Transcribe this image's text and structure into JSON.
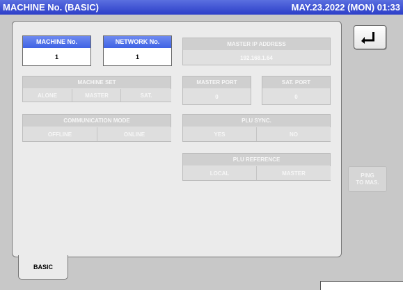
{
  "header": {
    "title": "MACHINE No. (BASIC)",
    "datetime": "MAY.23.2022 (MON) 01:33"
  },
  "machine_no": {
    "label": "MACHINE No.",
    "value": "1"
  },
  "network_no": {
    "label": "NETWORK No.",
    "value": "1"
  },
  "master_ip": {
    "label": "MASTER IP ADDRESS",
    "value": "192.168.1.64"
  },
  "machine_set": {
    "label": "MACHINE SET",
    "options": [
      "ALONE",
      "MASTER",
      "SAT."
    ]
  },
  "master_port": {
    "label": "MASTER PORT",
    "value": "0"
  },
  "sat_port": {
    "label": "SAT. PORT",
    "value": "0"
  },
  "comm_mode": {
    "label": "COMMUNICATION MODE",
    "options": [
      "OFFLINE",
      "ONLINE"
    ]
  },
  "plu_sync": {
    "label": "PLU SYNC.",
    "options": [
      "YES",
      "NO"
    ]
  },
  "plu_reference": {
    "label": "PLU REFERENCE",
    "options": [
      "LOCAL",
      "MASTER"
    ]
  },
  "buttons": {
    "ping": "PING\nTO MAS.",
    "back_icon": "return-arrow-icon"
  },
  "tabs": [
    "BASIC"
  ],
  "colors": {
    "titlebar": "#3a4fd8",
    "active_header": "#4b6de8",
    "panel": "#ebebeb",
    "disabled": "#e0e0e0"
  }
}
